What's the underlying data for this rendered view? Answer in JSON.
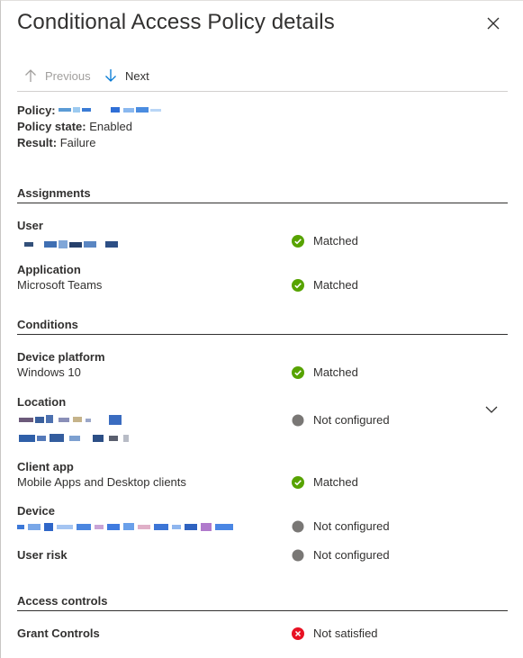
{
  "panel": {
    "title": "Conditional Access Policy details"
  },
  "toolbar": {
    "previous_label": "Previous",
    "next_label": "Next"
  },
  "info": {
    "policy_label": "Policy:",
    "policy_state_label": "Policy state:",
    "policy_state_value": "Enabled",
    "result_label": "Result:",
    "result_value": "Failure"
  },
  "sections": {
    "assignments": "Assignments",
    "conditions": "Conditions",
    "access_controls": "Access controls"
  },
  "rows": {
    "user": {
      "label": "User",
      "status": "Matched"
    },
    "application": {
      "label": "Application",
      "value": "Microsoft Teams",
      "status": "Matched"
    },
    "device_platform": {
      "label": "Device platform",
      "value": "Windows 10",
      "status": "Matched"
    },
    "location": {
      "label": "Location",
      "status": "Not configured"
    },
    "client_app": {
      "label": "Client app",
      "value": "Mobile Apps and Desktop clients",
      "status": "Matched"
    },
    "device": {
      "label": "Device",
      "status": "Not configured"
    },
    "user_risk": {
      "label": "User risk",
      "status": "Not configured"
    },
    "grant_controls": {
      "label": "Grant Controls",
      "status": "Not satisfied"
    }
  },
  "colors": {
    "matched": "#57a300",
    "not_configured": "#797775",
    "failed": "#e81123",
    "accent": "#0078d4"
  }
}
